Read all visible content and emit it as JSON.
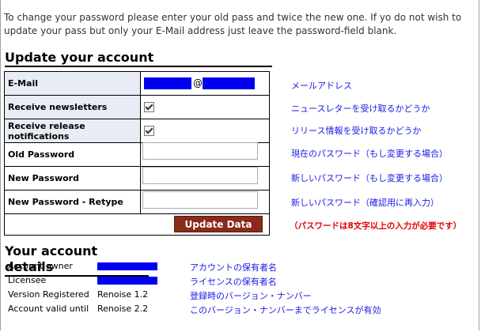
{
  "intro": "To change your password please enter your old pass and twice the new one. If yo do not wish to update your pass but only your E-Mail address just leave the password-field blank.",
  "update_title": "Update your account",
  "form": {
    "email_label": "E-Mail",
    "email_at": "@",
    "newsletters_label": "Receive newsletters",
    "release_label": "Receive release notifications",
    "old_pw_label": "Old Password",
    "new_pw_label": "New Password",
    "new_pw_retype_label": "New Password - Retype",
    "submit_label": "Update Data"
  },
  "notes": {
    "email": "メールアドレス",
    "newsletters": "ニュースレターを受け取るかどうか",
    "release": "リリース情報を受け取るかどうか",
    "old_pw": "現在のパスワード（もし変更する場合）",
    "new_pw": "新しいパスワード（もし変更する場合）",
    "new_pw_retype": "新しいパスワード（確認用に再入力）",
    "pw_rule": "（パスワードは8文字以上の入力が必要です）"
  },
  "details_title": "Your account details",
  "details": {
    "owner_label": "Account owner",
    "licensee_label": "Licensee",
    "version_label": "Version Registered",
    "version_value": "Renoise 1.2",
    "valid_label": "Account valid until",
    "valid_value": "Renoise 2.2",
    "owner_note": "アカウントの保有者名",
    "licensee_note": "ライセンスの保有者名",
    "version_note": "登録時のバージョン・ナンバー",
    "valid_note": "このバージョン・ナンバーまでライセンスが有効"
  },
  "colors": {
    "redaction": "#0000ee",
    "button": "#8a2a1a",
    "note_text": "#1a1ae6",
    "warning_text": "#e60000"
  }
}
